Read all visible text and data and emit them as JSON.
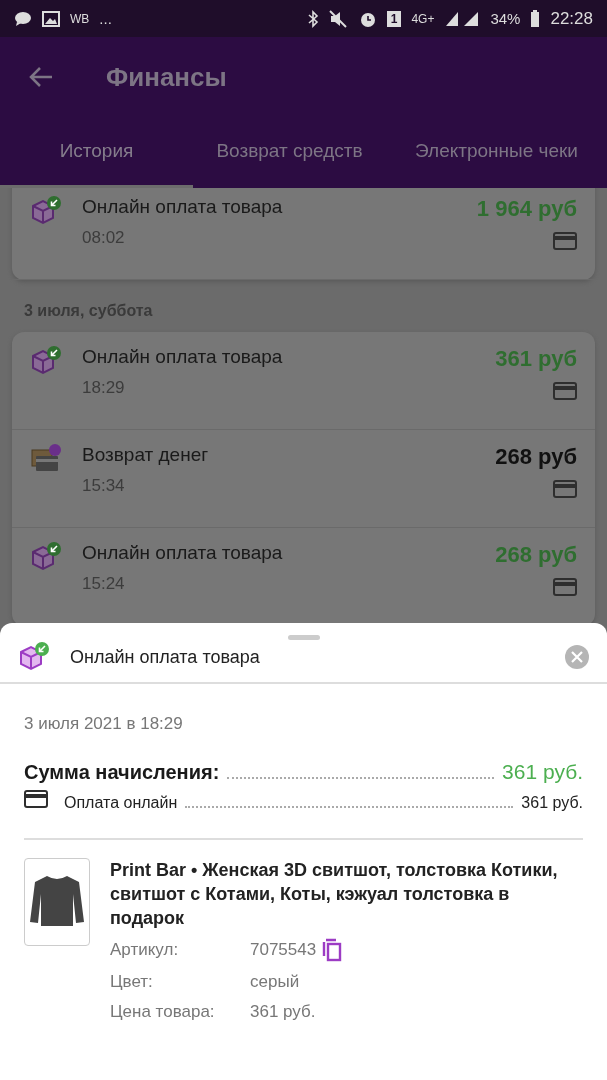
{
  "status_bar": {
    "notification_text": "WB",
    "more": "...",
    "network": "4G+",
    "sim": "1",
    "battery": "34%",
    "time": "22:28"
  },
  "app_bar": {
    "title": "Финансы"
  },
  "tabs": [
    {
      "label": "История",
      "selected": true
    },
    {
      "label": "Возврат средств",
      "selected": false
    },
    {
      "label": "Электронные чеки",
      "selected": false
    }
  ],
  "history": [
    {
      "kind": "payment",
      "title": "Онлайн оплата товара",
      "time": "08:02",
      "amount": "1 964 руб"
    },
    {
      "kind": "date",
      "title": "3 июля, суббота"
    },
    {
      "kind": "payment",
      "title": "Онлайн оплата товара",
      "time": "18:29",
      "amount": "361 руб"
    },
    {
      "kind": "refund",
      "title": "Возврат денег",
      "time": "15:34",
      "amount": "268 руб"
    },
    {
      "kind": "payment",
      "title": "Онлайн оплата товара",
      "time": "15:24",
      "amount": "268 руб"
    }
  ],
  "sheet": {
    "title": "Онлайн оплата товара",
    "date": "3 июля 2021 в 18:29",
    "total_label": "Сумма начисления:",
    "total_value": "361 руб.",
    "method_label": "Оплата онлайн",
    "method_value": "361 руб.",
    "product": {
      "name": "Print Bar • Женская 3D свитшот, толстовка Котики, свитшот с Котами, Коты, кэжуал толстовка в подарок",
      "details": [
        {
          "kind": "copyable",
          "label": "Артикул:",
          "value": "7075543"
        },
        {
          "kind": "plain",
          "label": "Цвет:",
          "value": "серый"
        },
        {
          "kind": "plain",
          "label": "Цена товара:",
          "value": "361 руб."
        }
      ]
    }
  }
}
